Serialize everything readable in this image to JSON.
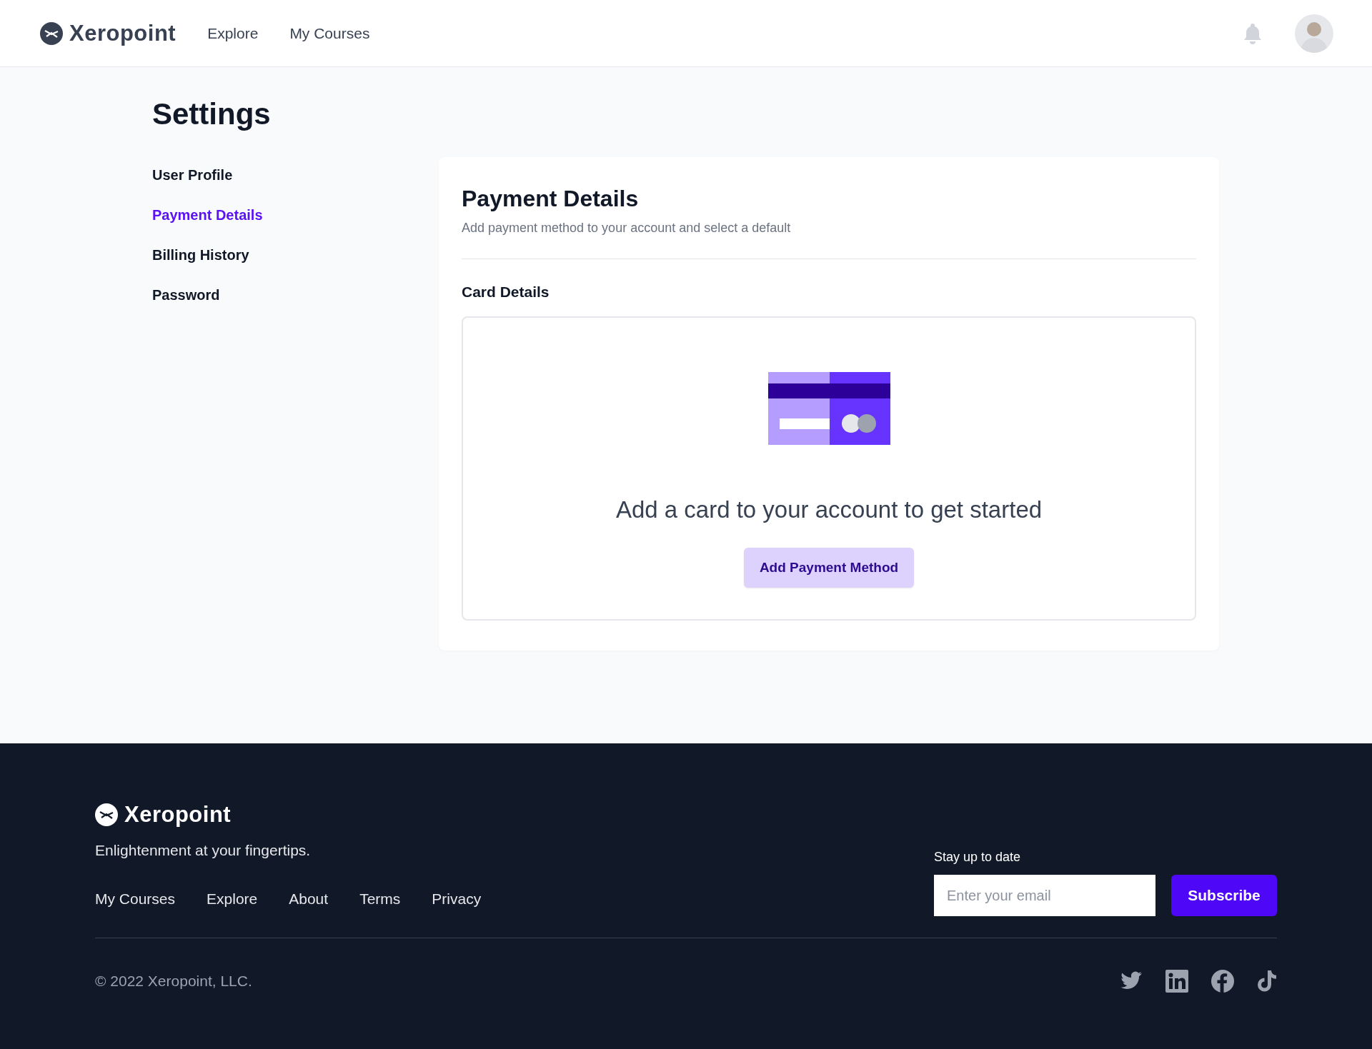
{
  "header": {
    "brand": "Xeropoint",
    "nav": [
      {
        "label": "Explore"
      },
      {
        "label": "My Courses"
      }
    ]
  },
  "page": {
    "title": "Settings"
  },
  "sidebar": {
    "items": [
      {
        "label": "User Profile",
        "selected": false
      },
      {
        "label": "Payment Details",
        "selected": true
      },
      {
        "label": "Billing History",
        "selected": false
      },
      {
        "label": "Password",
        "selected": false
      }
    ]
  },
  "panel": {
    "title": "Payment Details",
    "subtitle": "Add payment method to your account and select a default",
    "section": "Card Details",
    "empty_message": "Add a card to your account to get started",
    "button": "Add Payment Method"
  },
  "footer": {
    "brand": "Xeropoint",
    "tagline": "Enlightenment at your fingertips.",
    "links": [
      "My Courses",
      "Explore",
      "About",
      "Terms",
      "Privacy"
    ],
    "newsletter_label": "Stay up to date",
    "email": {
      "placeholder": "Enter your email"
    },
    "subscribe": "Subscribe",
    "copyright": "© 2022 Xeropoint, LLC.",
    "social": [
      {
        "kind": "twitter"
      },
      {
        "kind": "linkedin"
      },
      {
        "kind": "facebook"
      },
      {
        "kind": "tiktok"
      }
    ]
  }
}
